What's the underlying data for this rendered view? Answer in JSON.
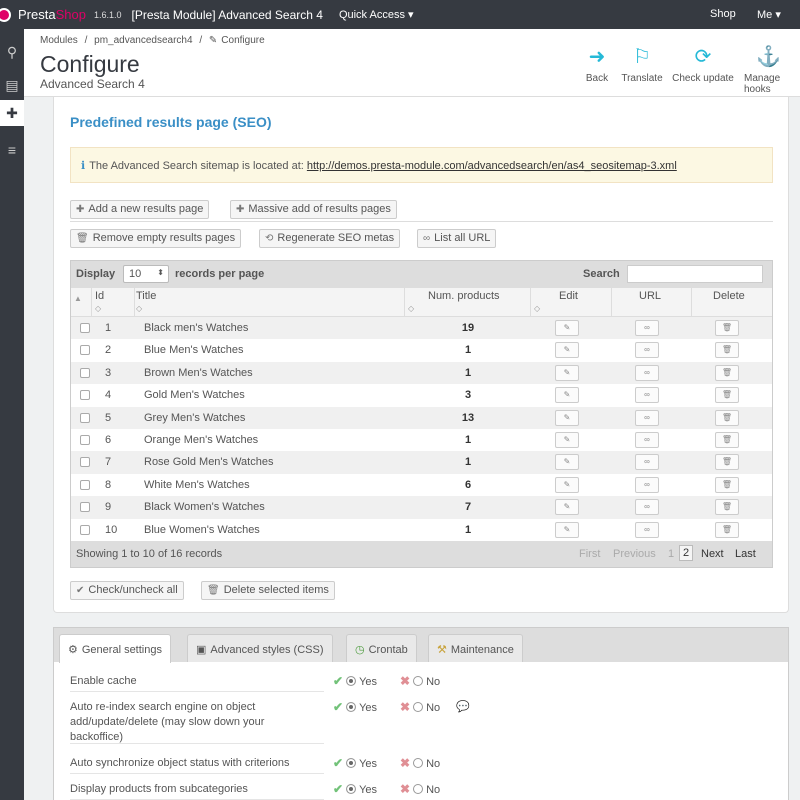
{
  "topbar": {
    "brand_a": "Presta",
    "brand_b": "Shop",
    "version": "1.6.1.0",
    "window_title": "[Presta Module] Advanced Search 4",
    "quick_access": "Quick Access ▾",
    "shop": "Shop",
    "me": "Me ▾"
  },
  "breadcrumb": [
    "Modules",
    "/",
    "pm_advancedsearch4",
    "/",
    "Configure"
  ],
  "page": {
    "title": "Configure",
    "subtitle": "Advanced Search 4"
  },
  "toolbar": [
    {
      "label": "Back",
      "icon": "back-circle-icon"
    },
    {
      "label": "Translate",
      "icon": "flag-icon"
    },
    {
      "label": "Check update",
      "icon": "refresh-icon"
    },
    {
      "label": "Manage hooks",
      "icon": "anchor-icon"
    }
  ],
  "seo": {
    "heading": "Predefined results page (SEO)",
    "alert_text": "The Advanced Search sitemap is located at:",
    "alert_link": "http://demos.presta-module.com/advancedsearch/en/as4_seositemap-3.xml",
    "buttons": {
      "add": "Add a new results page",
      "massive": "Massive add of results pages",
      "remove_empty": "Remove empty results pages",
      "regen": "Regenerate SEO metas",
      "list_url": "List all URL"
    }
  },
  "table": {
    "display": "Display",
    "per_page_value": "10",
    "per_page_suffix": "records per page",
    "search_label": "Search",
    "columns": {
      "id": "Id",
      "title": "Title",
      "num": "Num. products",
      "edit": "Edit",
      "url": "URL",
      "delete": "Delete"
    },
    "rows": [
      {
        "id": "1",
        "title": "Black men's Watches",
        "num": "19"
      },
      {
        "id": "2",
        "title": "Blue Men's Watches",
        "num": "1"
      },
      {
        "id": "3",
        "title": "Brown Men's Watches",
        "num": "1"
      },
      {
        "id": "4",
        "title": "Gold Men's Watches",
        "num": "3"
      },
      {
        "id": "5",
        "title": "Grey Men's Watches",
        "num": "13"
      },
      {
        "id": "6",
        "title": "Orange Men's Watches",
        "num": "1"
      },
      {
        "id": "7",
        "title": "Rose Gold Men's Watches",
        "num": "1"
      },
      {
        "id": "8",
        "title": "White Men's Watches",
        "num": "6"
      },
      {
        "id": "9",
        "title": "Black Women's Watches",
        "num": "7"
      },
      {
        "id": "10",
        "title": "Blue Women's Watches",
        "num": "1"
      }
    ],
    "status": "Showing 1 to 10 of 16 records",
    "pager": {
      "first": "First",
      "previous": "Previous",
      "p1": "1",
      "p2": "2",
      "next": "Next",
      "last": "Last"
    }
  },
  "bulk": {
    "check_all": "Check/uncheck all",
    "delete_selected": "Delete selected items"
  },
  "tabs": [
    {
      "label": "General settings",
      "icon": "gear-icon"
    },
    {
      "label": "Advanced styles (CSS)",
      "icon": "css-file-icon"
    },
    {
      "label": "Crontab",
      "icon": "clock-icon"
    },
    {
      "label": "Maintenance",
      "icon": "maintenance-icon"
    }
  ],
  "settings": [
    {
      "label": "Enable cache",
      "value": "Yes"
    },
    {
      "label": "Auto re-index search engine on object add/update/delete (may slow down your backoffice)",
      "value": "Yes"
    },
    {
      "label": "Auto synchronize object status with criterions",
      "value": "Yes"
    },
    {
      "label": "Display products from subcategories",
      "value": "Yes"
    }
  ],
  "yes_label": "Yes",
  "no_label": "No",
  "colors": {
    "accent": "#25b9d7",
    "heading": "#3a8fc6",
    "brand": "#df0067",
    "topbar": "#363a41"
  }
}
